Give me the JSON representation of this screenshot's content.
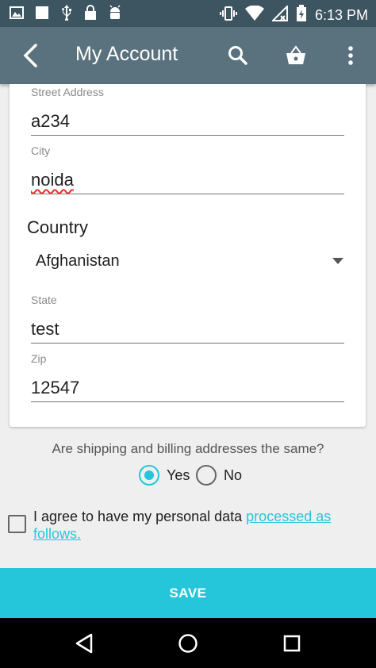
{
  "status_bar": {
    "time": "6:13 PM",
    "left_icons": [
      "image-icon",
      "square-icon",
      "usb-icon",
      "lock-icon",
      "android-icon"
    ],
    "right_icons": [
      "vibrate-icon",
      "wifi-icon",
      "no-signal-icon",
      "battery-charging-icon"
    ]
  },
  "app_bar": {
    "title": "My Account",
    "back_icon": "back-arrow-icon",
    "search_icon": "search-icon",
    "cart_icon": "shopping-basket-icon",
    "menu_icon": "more-vert-icon",
    "color": "#5a717e"
  },
  "form": {
    "street": {
      "label": "Street Address",
      "value": "a234"
    },
    "city": {
      "label": "City",
      "value": "noida"
    },
    "country": {
      "label": "Country",
      "value": "Afghanistan"
    },
    "state": {
      "label": "State",
      "value": "test"
    },
    "zip": {
      "label": "Zip",
      "value": "12547"
    }
  },
  "same_address": {
    "question": "Are shipping and billing addresses the same?",
    "options": [
      {
        "label": "Yes",
        "selected": true
      },
      {
        "label": "No",
        "selected": false
      }
    ]
  },
  "consent": {
    "text": "I agree to have my personal data ",
    "link": "processed as follows.",
    "checked": false
  },
  "save_label": "SAVE",
  "accent_color": "#26c6da",
  "nav_bar": {
    "icons": [
      "back-triangle-icon",
      "home-circle-icon",
      "recents-square-icon"
    ]
  }
}
